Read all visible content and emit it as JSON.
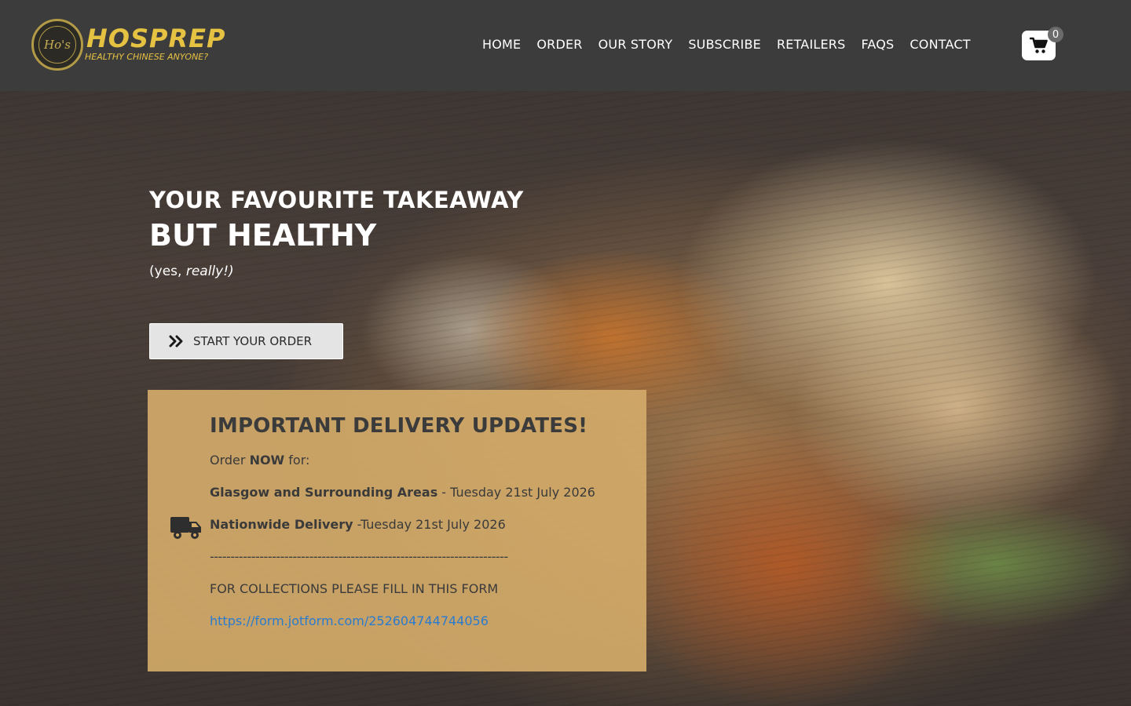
{
  "header": {
    "logo": {
      "emblem_text": "Ho's",
      "wordmark": "HOSPREP",
      "tagline": "HEALTHY CHINESE ANYONE?"
    },
    "nav": [
      {
        "label": "HOME"
      },
      {
        "label": "ORDER"
      },
      {
        "label": "OUR STORY"
      },
      {
        "label": "SUBSCRIBE"
      },
      {
        "label": "RETAILERS"
      },
      {
        "label": "FAQS"
      },
      {
        "label": "CONTACT"
      }
    ],
    "cart": {
      "icon": "shopping-cart-icon",
      "count": "0"
    }
  },
  "hero": {
    "line1": "YOUR FAVOURITE TAKEAWAY",
    "line2": "BUT HEALTHY",
    "line3_prefix": "(yes, ",
    "line3_emphasis": "really!)",
    "cta": {
      "icon": "double-chevron-right-icon",
      "label": "START YOUR ORDER"
    }
  },
  "delivery_panel": {
    "icon": "truck-icon",
    "title": "IMPORTANT DELIVERY UPDATES!",
    "order_prefix": "Order ",
    "order_bold": "NOW",
    "order_suffix": " for:",
    "glasgow_bold": "Glasgow and Surrounding Areas",
    "glasgow_rest": " - Tuesday 21st July 2026",
    "nationwide_bold": "Nationwide Delivery",
    "nationwide_rest": " -Tuesday 21st July 2026",
    "divider": "------------------------------------------------------------------------",
    "collections_text": "FOR COLLECTIONS PLEASE FILL IN THIS FORM",
    "form_link": "https://form.jotform.com/252604744744056"
  },
  "colors": {
    "header_bg": "#3d3c3d",
    "brand_gold": "#e6c242",
    "panel_bg": "#d2aa69",
    "link": "#2a7bd0"
  }
}
